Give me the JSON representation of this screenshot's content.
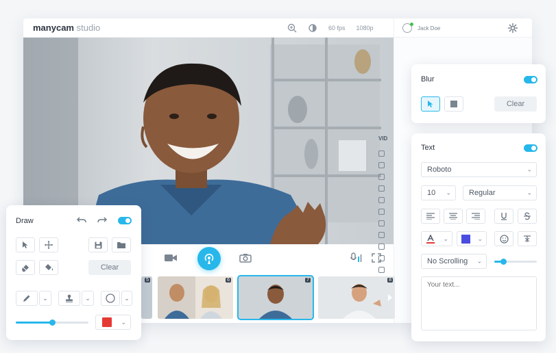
{
  "app": {
    "logo_main": "manycam",
    "logo_sub": " studio",
    "fps": "60 fps",
    "resolution": "1080p",
    "user_name": "Jack Doe"
  },
  "sidebar": {
    "section_label": "VID"
  },
  "thumbnails": [
    {
      "num": "5"
    },
    {
      "num": "6"
    },
    {
      "num": "7"
    },
    {
      "num": "8"
    }
  ],
  "blur_panel": {
    "title": "Blur",
    "clear_label": "Clear",
    "enabled": true
  },
  "text_panel": {
    "title": "Text",
    "font": "Roboto",
    "size": "10",
    "weight": "Regular",
    "text_color": "#e53935",
    "bg_color": "#4a4de0",
    "scrolling": "No Scrolling",
    "placeholder": "Your text...",
    "enabled": true
  },
  "draw_panel": {
    "title": "Draw",
    "clear_label": "Clear",
    "brush_color": "#e53935",
    "size_level": 0.5,
    "enabled": true
  },
  "colors": {
    "accent": "#27b7ea"
  }
}
